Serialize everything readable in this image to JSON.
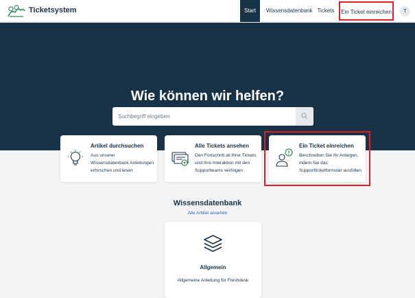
{
  "header": {
    "brand": "Ticketsystem",
    "nav": {
      "start": "Start",
      "wissensdatenbank": "Wissensdatenbank",
      "tickets": "Tickets",
      "submit_ticket": "Ein Ticket einreichen"
    },
    "avatar_initial": "T"
  },
  "hero": {
    "title": "Wie können wir helfen?",
    "search_placeholder": "Suchbegriff eingeben",
    "search_icon": "search-icon"
  },
  "cards": [
    {
      "title": "Artikel durchsuchen",
      "description": "Aus unserer Wissensdatenbank Anleitungen erforschen und lesen",
      "icon": "lightbulb-icon"
    },
    {
      "title": "Alle Tickets ansehen",
      "description": "Den Fortschritt all Ihrer Tickets und Ihre Interaktion mit den Supportteams verfolgen",
      "icon": "tickets-icon"
    },
    {
      "title": "Ein Ticket einreichen",
      "description": "Beschreiben Sie Ihr Anliegen, indem Sie das Supportticketformular ausfüllen",
      "icon": "person-alert-icon"
    }
  ],
  "knowledge_base": {
    "title": "Wissensdatenbank",
    "view_all": "Alle Artikel ansehen",
    "category": {
      "title": "Allgemein",
      "description": "Allgemeine Anleitung für Freshdesk",
      "icon": "layers-icon"
    }
  },
  "colors": {
    "navy": "#183247",
    "accent_green": "#2e8b57",
    "highlight_red": "#e02020",
    "link_blue": "#2c5cc5"
  }
}
